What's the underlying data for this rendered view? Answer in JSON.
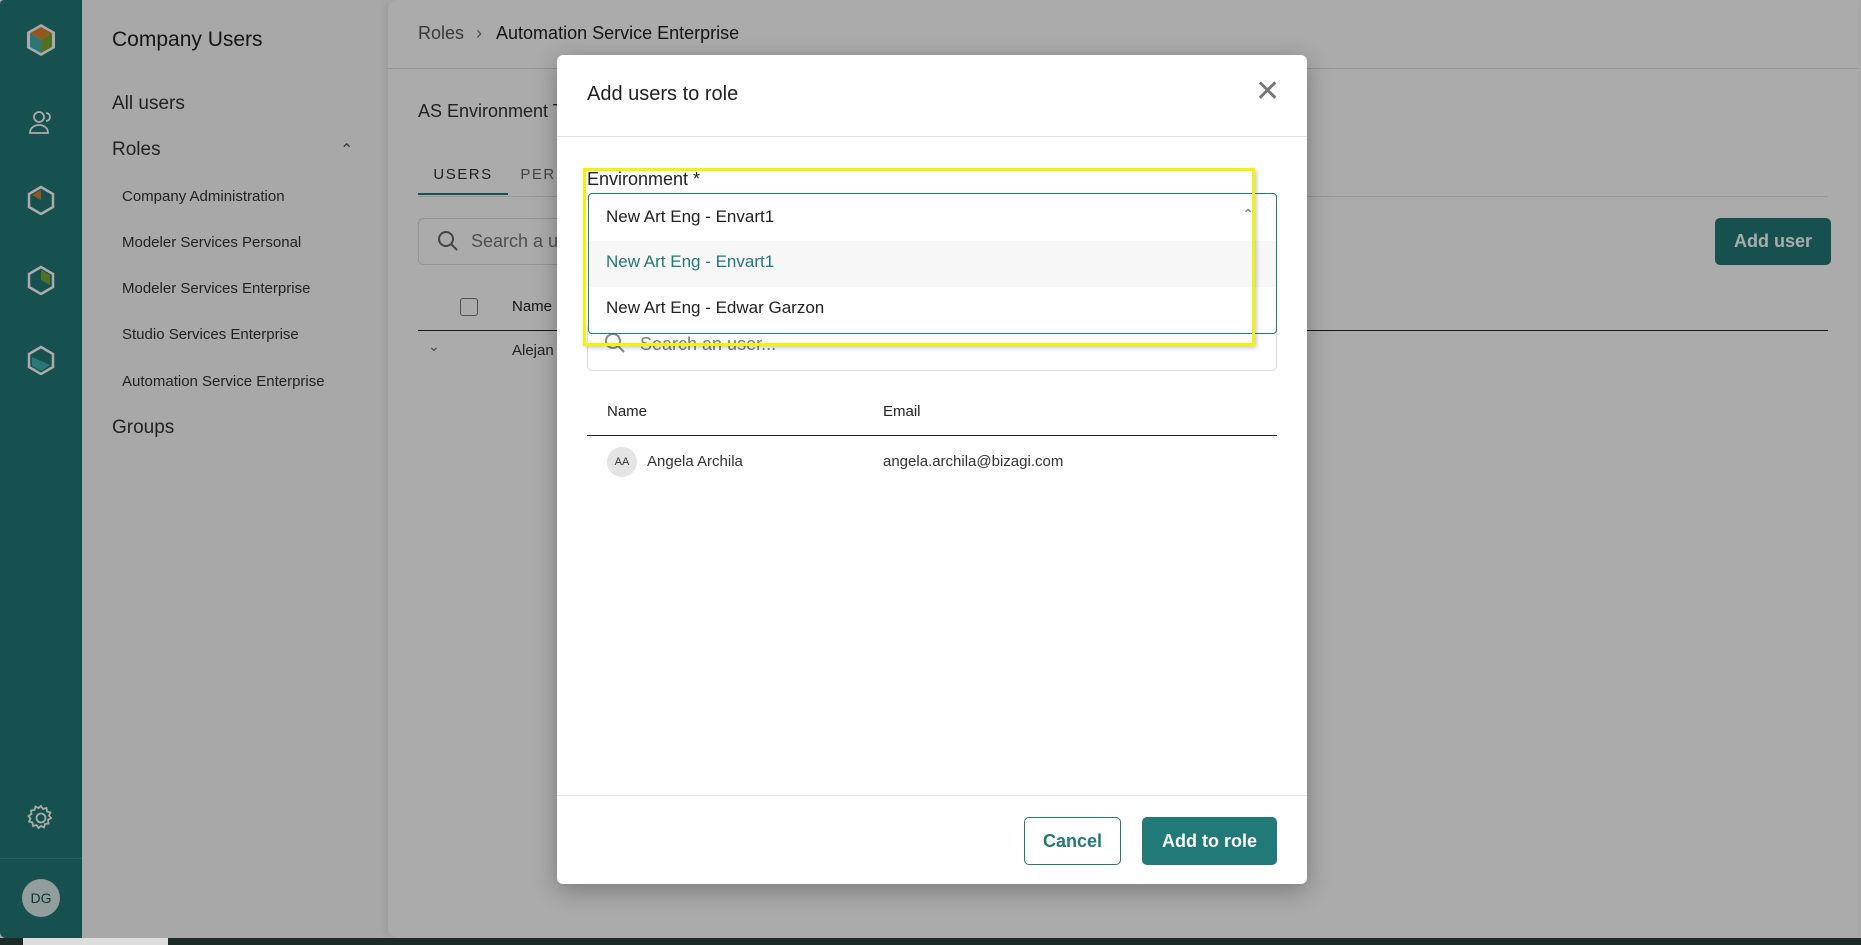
{
  "rail": {
    "icons": [
      "logo-icon",
      "users-icon",
      "modeler-icon",
      "studio-icon",
      "automation-icon",
      "settings-icon"
    ],
    "avatar": "DG",
    "color": "#217a77"
  },
  "nav": {
    "title": "Company Users",
    "all_users": "All users",
    "roles": "Roles",
    "roles_items": [
      "Company Administration",
      "Modeler Services Personal",
      "Modeler Services Enterprise",
      "Studio Services Enterprise",
      "Automation Service Enterprise"
    ],
    "groups": "Groups"
  },
  "main": {
    "breadcrumb_root": "Roles",
    "breadcrumb_current": "Automation Service Enterprise",
    "env_title": "AS Environment T",
    "tabs": [
      "USERS",
      "PER"
    ],
    "search_placeholder": "Search a us",
    "add_user": "Add user",
    "col_name": "Name",
    "row_name": "Alejan"
  },
  "modal": {
    "title": "Add users to role",
    "env_label": "Environment *",
    "selected": "New Art Eng - Envart1",
    "options": [
      "New Art Eng - Envart1",
      "New Art Eng - Edwar Garzon"
    ],
    "search_placeholder": "Search an user...",
    "col_name": "Name",
    "col_email": "Email",
    "users": [
      {
        "initials": "AA",
        "name": "Angela Archila",
        "email": "angela.archila@bizagi.com"
      }
    ],
    "cancel": "Cancel",
    "add_to_role": "Add to role"
  },
  "colors": {
    "accent": "#217a77",
    "highlight": "#f2f20a"
  }
}
